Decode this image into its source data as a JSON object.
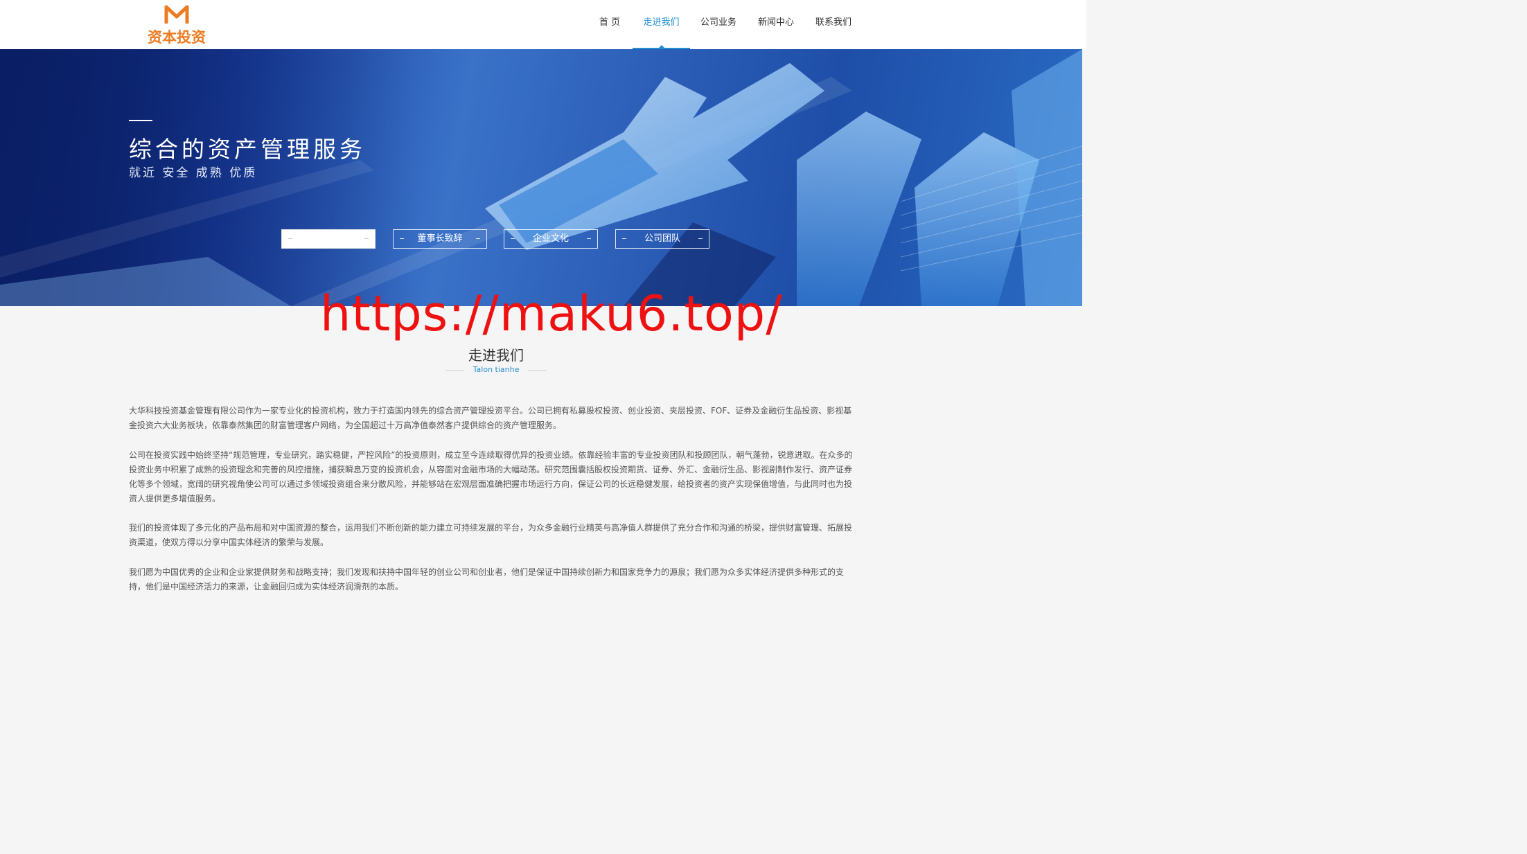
{
  "header": {
    "logo_text": "资本投资",
    "nav": [
      {
        "label": "首 页"
      },
      {
        "label": "走进我们"
      },
      {
        "label": "公司业务"
      },
      {
        "label": "新闻中心"
      },
      {
        "label": "联系我们"
      }
    ],
    "active_index": 1
  },
  "banner": {
    "title": "综合的资产管理服务",
    "subtitle": "就近 安全 成熟 优质",
    "tabs": [
      {
        "label": ""
      },
      {
        "label": "董事长致辞"
      },
      {
        "label": "企业文化"
      },
      {
        "label": "公司团队"
      }
    ]
  },
  "watermark": "https://maku6.top/",
  "section": {
    "title": "走进我们",
    "subtitle": "Talon tianhe",
    "paragraphs": [
      "大华科技投资基金管理有限公司作为一家专业化的投资机构，致力于打造国内领先的综合资产管理投资平台。公司已拥有私募股权投资、创业投资、夹层投资、FOF、证券及金融衍生品投资、影视基金投资六大业务板块，依靠泰然集团的财富管理客户网络，为全国超过十万高净值泰然客户提供综合的资产管理服务。",
      "公司在投资实践中始终坚持“规范管理，专业研究，踏实稳健，严控风险”的投资原则，成立至今连续取得优异的投资业绩。依靠经验丰富的专业投资团队和投顾团队，朝气蓬勃，锐意进取。在众多的投资业务中积累了成熟的投资理念和完善的风控措施，捕获瞬息万变的投资机会，从容面对金融市场的大幅动荡。研究范围囊括股权投资期货、证券、外汇、金融衍生品、影视剧制作发行、资产证券化等多个领域，宽阔的研究视角使公司可以通过多领域投资组合来分散风险，并能够站在宏观层面准确把握市场运行方向，保证公司的长远稳健发展，给投资者的资产实现保值增值，与此同时也为投资人提供更多增值服务。",
      "我们的投资体现了多元化的产品布局和对中国资源的整合，运用我们不断创新的能力建立可持续发展的平台，为众多金融行业精英与高净值人群提供了充分合作和沟通的桥梁，提供财富管理、拓展投资渠道，使双方得以分享中国实体经济的繁荣与发展。",
      "我们愿为中国优秀的企业和企业家提供财务和战略支持；我们发现和扶持中国年轻的创业公司和创业者，他们是保证中国持续创新力和国家竞争力的源泉；我们愿为众多实体经济提供多种形式的支持，他们是中国经济活力的来源，让金融回归成为实体经济润滑剂的本质。"
    ]
  },
  "colors": {
    "accent": "#1f8ed1",
    "logo": "#ee7b22",
    "watermark": "#ee1111"
  }
}
